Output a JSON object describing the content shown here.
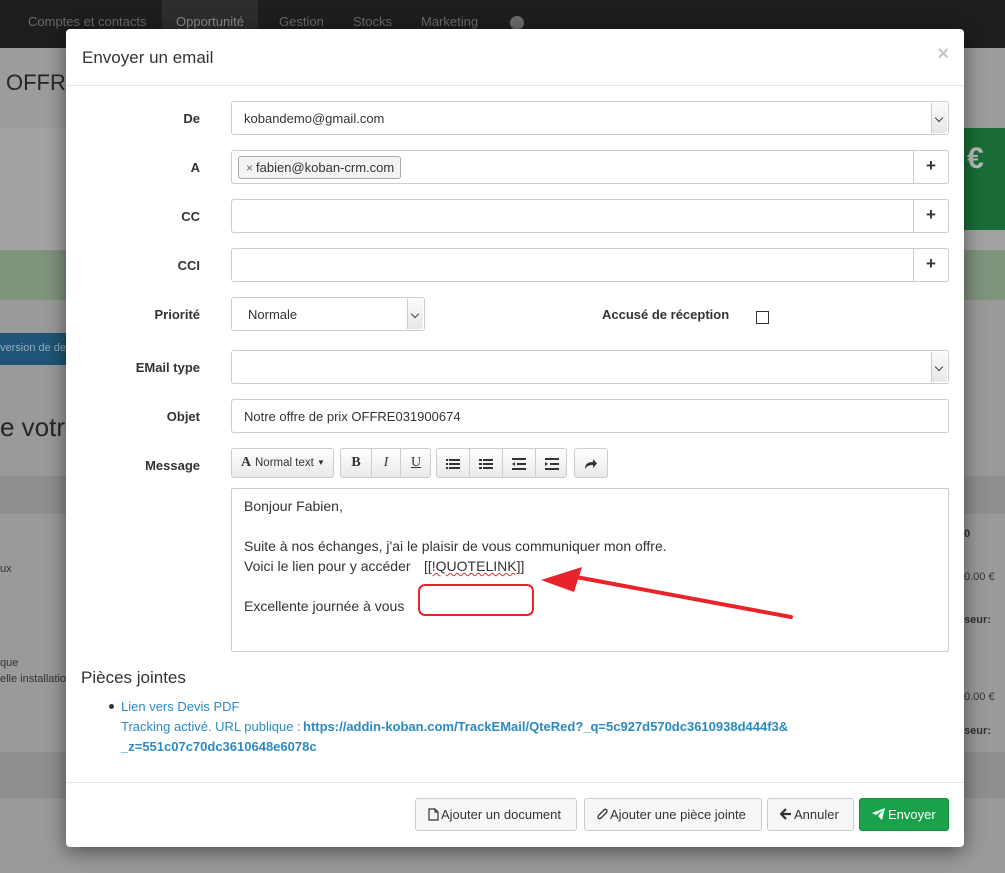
{
  "background": {
    "nav_tabs": [
      "Comptes et contacts",
      "Opportunité",
      "Gestion",
      "Stocks",
      "Marketing"
    ],
    "title_fragment": "OFFRE",
    "euro_fragment": "€",
    "button_fragment": "version de dev",
    "heading_fragment": "e votr",
    "amount_1": "0.00 €",
    "amount_2": "0.00 €",
    "label_1": "seur:",
    "label_2": "seur:",
    "col_header": "0",
    "text_1": "ux",
    "text_2": "que",
    "text_3": "elle installation"
  },
  "modal": {
    "title": "Envoyer un email",
    "close": "×",
    "labels": {
      "from": "De",
      "to": "A",
      "cc": "CC",
      "bcc": "CCI",
      "priority": "Priorité",
      "receipt": "Accusé de réception",
      "email_type": "EMail type",
      "subject": "Objet",
      "message": "Message"
    },
    "from_value": "kobandemo@gmail.com",
    "to_tag": "fabien@koban-crm.com",
    "to_tag_remove": "×",
    "add_symbol": "+",
    "priority_value": "Normale",
    "email_type_value": "",
    "subject_value": "Notre offre de prix OFFRE031900674",
    "toolbar": {
      "style_label": "Normal text",
      "bold": "B",
      "italic": "I",
      "underline": "U"
    },
    "message": {
      "greeting": "Bonjour Fabien,",
      "line1": "Suite à nos échanges, j'ai le plaisir de vous communiquer mon offre.",
      "line2": "Voici le lien pour y accéder",
      "placeholder": "[[!QUOTELINK]]",
      "closing": "Excellente journée à vous"
    },
    "attachments": {
      "title": "Pièces jointes",
      "item_link": "Lien vers Devis PDF",
      "tracking_prefix": "Tracking activé. URL publique :",
      "tracking_url_1": "https://addin-koban.com/TrackEMail/QteRed?_q=5c927d570dc3610938d444f3&",
      "tracking_url_2": "_z=551c07c70dc3610648e6078c"
    },
    "buttons": {
      "add_document": "Ajouter un document",
      "add_attachment": "Ajouter une pièce jointe",
      "cancel": "Annuler",
      "send": "Envoyer"
    },
    "colors": {
      "link": "#2a8ac4",
      "send": "#1aa14a",
      "highlight": "#e8232a"
    }
  }
}
